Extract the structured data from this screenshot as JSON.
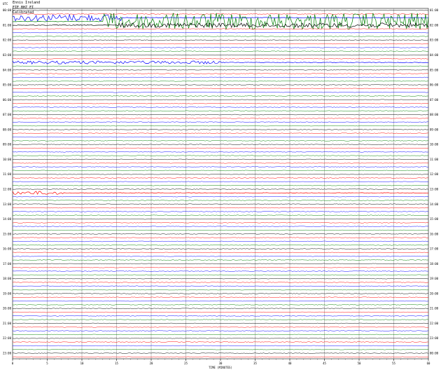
{
  "header": {
    "station": "Ennis Ireland",
    "channel": "EIE BHZ EI",
    "scale": "Calibrated",
    "corner_label": "UTC"
  },
  "colors": {
    "black": "#000000",
    "red": "#ff0000",
    "blue": "#0000ff",
    "green": "#008000",
    "grid": "#8a8a8a"
  },
  "chart_data": {
    "type": "line",
    "description_kind": "helicorder",
    "color_cycle": [
      "black",
      "red",
      "blue",
      "green"
    ],
    "trace_count": 94,
    "minute_ticks": [
      "0",
      "5",
      "10",
      "15",
      "20",
      "25",
      "30",
      "35",
      "40",
      "45",
      "50",
      "55",
      "60"
    ],
    "left_time_labels": [
      "00:00",
      "01:00",
      "02:00",
      "03:00",
      "04:00",
      "05:00",
      "06:00",
      "07:00",
      "08:00",
      "09:00",
      "10:00",
      "11:00",
      "12:00",
      "13:00",
      "14:00",
      "15:00",
      "16:00",
      "17:00",
      "18:00",
      "19:00",
      "20:00",
      "21:00",
      "22:00",
      "23:00"
    ],
    "right_time_labels": [
      "01:00",
      "02:00",
      "03:00",
      "04:00",
      "05:00",
      "06:00",
      "07:00",
      "08:00",
      "09:00",
      "10:00",
      "11:00",
      "12:00",
      "13:00",
      "14:00",
      "15:00",
      "16:00",
      "17:00",
      "18:00",
      "19:00",
      "20:00",
      "21:00",
      "22:00",
      "23:00",
      "00:00"
    ],
    "footer_label": "TIME (MINUTES)",
    "noisy_traces": [
      {
        "index": 2,
        "amplitude": 1.8,
        "start": 0.0,
        "end": 0.26
      },
      {
        "index": 3,
        "amplitude": 4.5,
        "start": 0.22,
        "end": 1.0
      },
      {
        "index": 4,
        "amplitude": 1.2,
        "start": 0.25,
        "end": 1.0
      },
      {
        "index": 14,
        "amplitude": 0.8,
        "start": 0.0,
        "end": 0.5
      },
      {
        "index": 49,
        "amplitude": 0.9,
        "start": 0.0,
        "end": 0.12
      }
    ]
  }
}
